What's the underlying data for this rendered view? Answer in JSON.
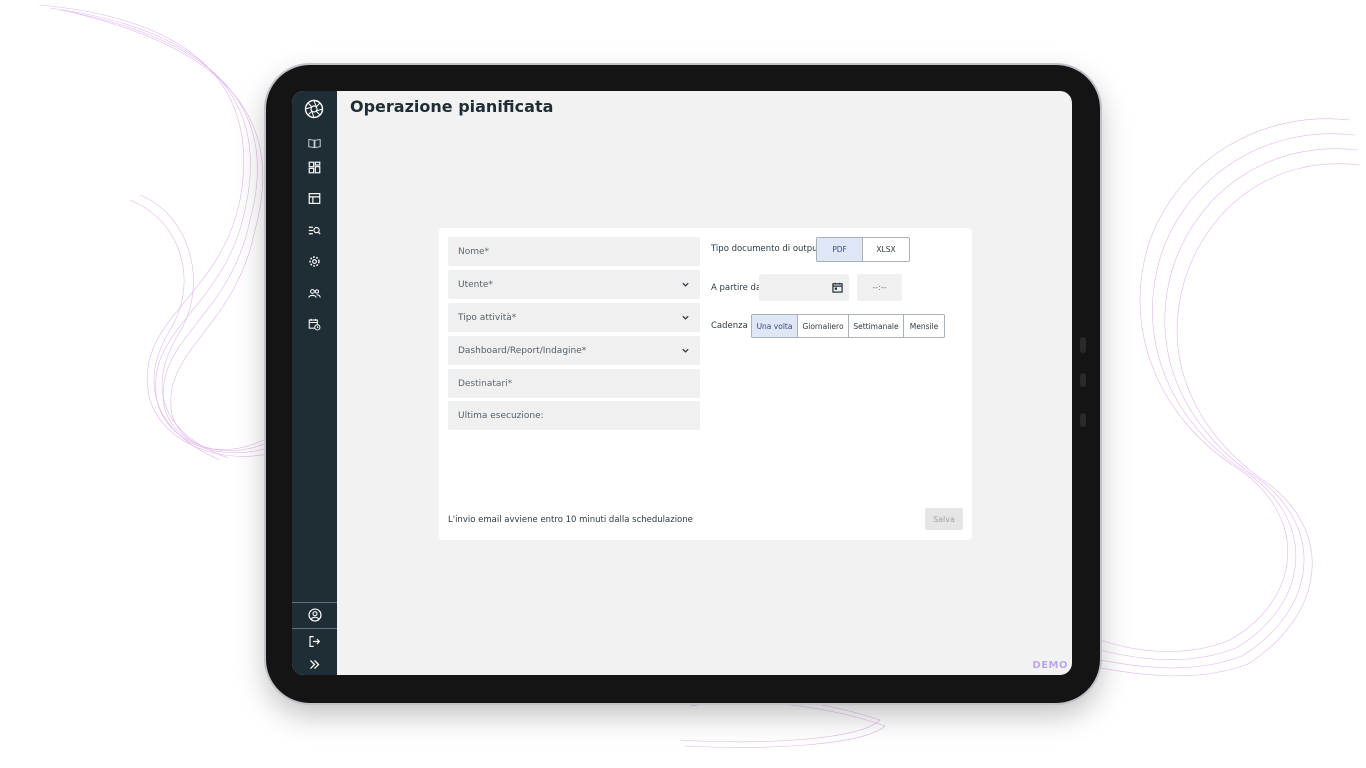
{
  "page": {
    "title": "Operazione pianificata",
    "watermark": "DEMO"
  },
  "sidebar": {
    "logo_icon": "aperture-logo-icon",
    "items": [
      {
        "icon": "open-book-icon"
      },
      {
        "icon": "dashboard-icon"
      },
      {
        "icon": "table-icon"
      },
      {
        "icon": "list-search-icon"
      },
      {
        "icon": "gear-icon"
      },
      {
        "icon": "users-icon"
      },
      {
        "icon": "calendar-clock-icon"
      }
    ],
    "bottom": [
      {
        "icon": "user-circle-icon"
      },
      {
        "icon": "logout-icon"
      },
      {
        "icon": "double-chevron-right-icon"
      }
    ]
  },
  "form": {
    "nome_placeholder": "Nome*",
    "utente_placeholder": "Utente*",
    "tipo_attivita_placeholder": "Tipo attività*",
    "dashboard_placeholder": "Dashboard/Report/Indagine*",
    "destinatari_placeholder": "Destinatari*",
    "ultima_esecuzione_label": "Ultima esecuzione:",
    "output_label": "Tipo documento di output",
    "output_options": [
      "PDF",
      "XLSX"
    ],
    "output_selected": "PDF",
    "start_label": "A partire da",
    "time_placeholder": "--:--",
    "cadence_label": "Cadenza",
    "cadence_options": [
      "Una volta",
      "Giornaliero",
      "Settimanale",
      "Mensile"
    ],
    "cadence_selected": "Una volta",
    "note": "L'invio email avviene entro 10 minuti dalla schedulazione",
    "save_label": "Salva"
  },
  "colors": {
    "sidebar_bg": "#1f2d35",
    "selected_option": "#dfe7f7",
    "accent_decor": "#c77dde"
  }
}
